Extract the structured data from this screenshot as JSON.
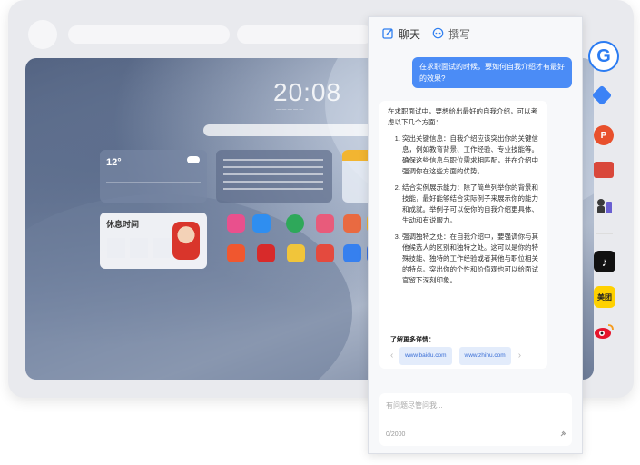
{
  "desktop": {
    "clock": "20:08",
    "weather_temp": "12°",
    "rest_widget_title": "休息时间"
  },
  "tabs": [
    {
      "label": "聊天",
      "icon": "edit-icon"
    },
    {
      "label": "撰写",
      "icon": "chat-bubble-icon"
    }
  ],
  "user_message": "在求职面试的时候，要如何自我介绍才有最好的效果?",
  "answer": {
    "intro": "在求职面试中，要想给出最好的自我介绍，可以考虑以下几个方面：",
    "points": [
      "突出关键信息：自我介绍应该突出你的关键信息，例如教育背景、工作经验、专业技能等。确保这些信息与职位需求相匹配，并在介绍中强调你在这些方面的优势。",
      "结合实例展示能力：除了简单列举你的背景和技能，最好能够结合实际例子来展示你的能力和成就。举例子可以使你的自我介绍更具体、生动和有说服力。",
      "强调独特之处：在自我介绍中，要强调你与其他候选人的区别和独特之处。这可以是你的特殊技能、独特的工作经验或者其他与职位相关的特点。突出你的个性和价值观也可以给面试官留下深刻印象。"
    ],
    "more_label": "了解更多详情：",
    "links": [
      "www.baidu.com",
      "www.zhihu.com"
    ]
  },
  "input": {
    "placeholder": "有问题尽管问我...",
    "counter": "0/2000"
  },
  "side_icons": [
    "g-logo-icon",
    "tag-icon",
    "powerpoint-icon",
    "toolbox-icon",
    "chess-icon",
    "tiktok-icon",
    "meituan-icon",
    "weibo-icon"
  ],
  "side_labels": {
    "meituan": "美团"
  },
  "colors": {
    "accent": "#4b8cf6",
    "panel_bg": "#f7f8fa"
  }
}
